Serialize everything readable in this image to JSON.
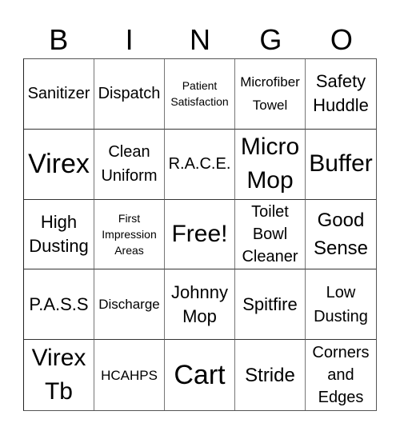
{
  "header": {
    "letters": [
      "B",
      "I",
      "N",
      "G",
      "O"
    ]
  },
  "card": {
    "rows": [
      [
        "Sanitizer",
        "Dispatch",
        "Patient\nSatisfaction",
        "Microfiber\nTowel",
        "Safety\nHuddle"
      ],
      [
        "Virex",
        "Clean\nUniform",
        "R.A.C.E.",
        "Micro\nMop",
        "Buffer"
      ],
      [
        "High\nDusting",
        "First\nImpression\nAreas",
        "Free!",
        "Toilet\nBowl\nCleaner",
        "Good\nSense"
      ],
      [
        "P.A.S.S",
        "Discharge",
        "Johnny\nMop",
        "Spitfire",
        "Low\nDusting"
      ],
      [
        "Virex\nTb",
        "HCAHPS",
        "Cart",
        "Stride",
        "Corners\nand\nEdges"
      ]
    ],
    "free_space": "Free!"
  }
}
